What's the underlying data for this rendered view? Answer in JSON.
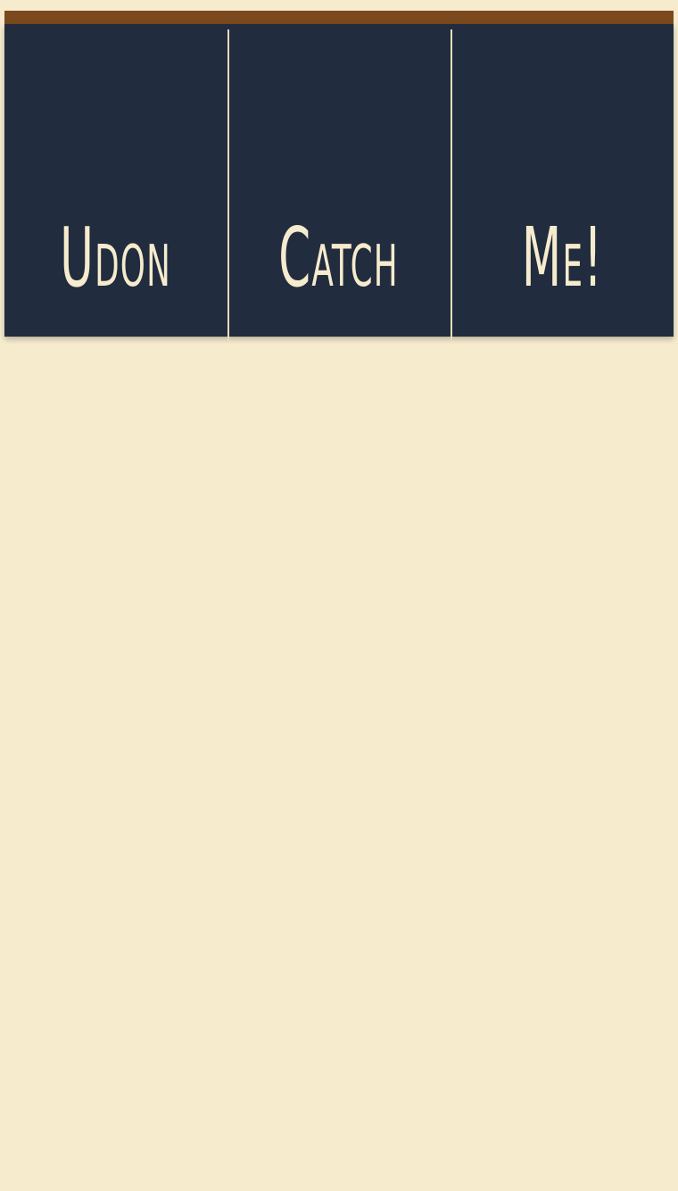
{
  "colors": {
    "background": "#f6ebcd",
    "top_bar": "#7a4a1e",
    "header_bg": "#212c3e",
    "header_text": "#f6ebcd",
    "divider": "#e8dcbc"
  },
  "header": {
    "tiles": [
      {
        "label": "Udon"
      },
      {
        "label": "Catch"
      },
      {
        "label": "Me!"
      }
    ]
  }
}
